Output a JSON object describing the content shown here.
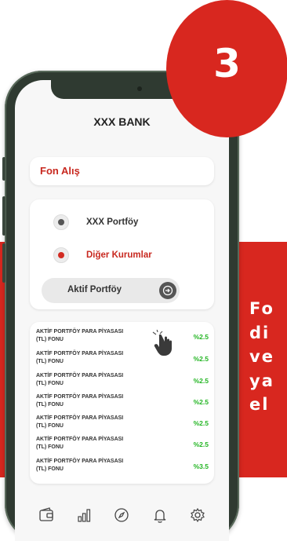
{
  "step_badge": "3",
  "promo": {
    "lines": [
      "Fo",
      "di",
      "ve",
      "ya",
      "el"
    ]
  },
  "app": {
    "title": "XXX BANK",
    "section_label": "Fon Alış",
    "options": [
      {
        "label": "XXX Portföy",
        "selected": false
      },
      {
        "label": "Diğer Kurumlar",
        "selected": true
      }
    ],
    "sub_option": {
      "label": "Aktif Portföy"
    },
    "funds": [
      {
        "name_line1": "AKTİF PORTFÖY PARA PİYASASI",
        "name_line2": "(TL) FONU",
        "rate": "%2.5"
      },
      {
        "name_line1": "AKTİF PORTFÖY PARA PİYASASI",
        "name_line2": "(TL) FONU",
        "rate": "%2.5"
      },
      {
        "name_line1": "AKTİF PORTFÖY PARA PİYASASI",
        "name_line2": "(TL) FONU",
        "rate": "%2.5"
      },
      {
        "name_line1": "AKTİF PORTFÖY PARA PİYASASI",
        "name_line2": "(TL) FONU",
        "rate": "%2.5"
      },
      {
        "name_line1": "AKTİF PORTFÖY PARA PİYASASI",
        "name_line2": "(TL) FONU",
        "rate": "%2.5"
      },
      {
        "name_line1": "AKTİF PORTFÖY PARA PİYASASI",
        "name_line2": "(TL) FONU",
        "rate": "%2.5"
      },
      {
        "name_line1": "AKTİF PORTFÖY PARA PİYASASI",
        "name_line2": "(TL) FONU",
        "rate": "%3.5"
      }
    ],
    "tab_icons": [
      "wallet-icon",
      "bar-chart-icon",
      "compass-icon",
      "bell-icon",
      "gear-icon"
    ]
  },
  "colors": {
    "brand_red": "#d8271f",
    "rate_green": "#22b522"
  }
}
